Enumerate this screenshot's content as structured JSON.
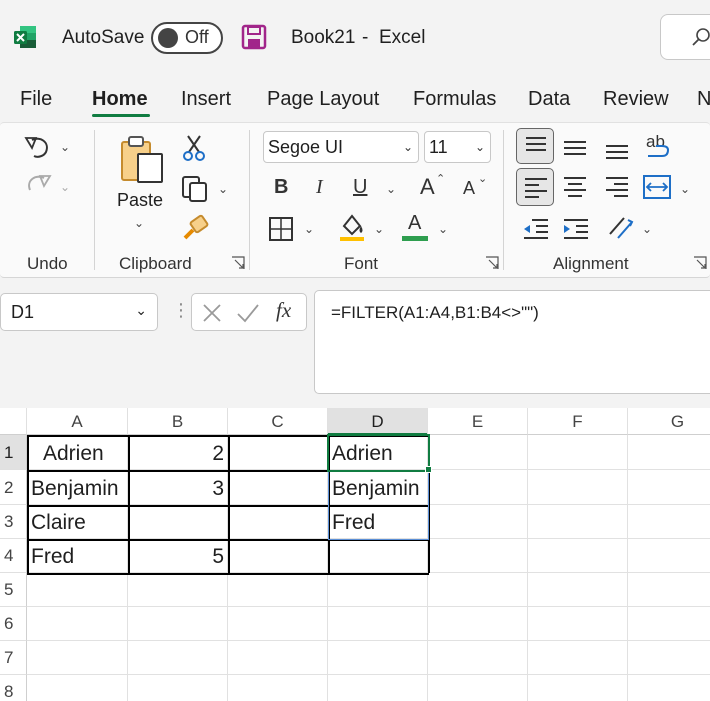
{
  "titlebar": {
    "autosave_label": "AutoSave",
    "autosave_state": "Off",
    "doc_title": "Book21",
    "separator": "-",
    "app_name": "Excel"
  },
  "tabs": [
    "File",
    "Home",
    "Insert",
    "Page Layout",
    "Formulas",
    "Data",
    "Review",
    "N"
  ],
  "active_tab": "Home",
  "ribbon": {
    "groups": {
      "undo": "Undo",
      "clipboard": "Clipboard",
      "font": "Font",
      "alignment": "Alignment"
    },
    "paste_label": "Paste",
    "font_name": "Segoe UI",
    "font_size": "11",
    "bold": "B",
    "italic": "I",
    "underline": "U",
    "grow_font": "A",
    "shrink_font": "A",
    "font_color": "A",
    "wrap_text": "ab",
    "colors": {
      "accent": "#107c41",
      "font_color_bar": "#2e9e4f",
      "fill_bar": "#ffc000"
    }
  },
  "formula_bar": {
    "name_box": "D1",
    "fx": "fx",
    "formula": "=FILTER(A1:A4,B1:B4<>\"\")"
  },
  "sheet": {
    "columns": [
      "A",
      "B",
      "C",
      "D",
      "E",
      "F",
      "G"
    ],
    "selected_column": "D",
    "rows": [
      "1",
      "2",
      "3",
      "4",
      "5",
      "6",
      "7",
      "8"
    ],
    "selected_row": "1",
    "cells": {
      "A1": "Adrien",
      "B1": "2",
      "D1": "Adrien",
      "A2": "Benjamin",
      "B2": "3",
      "D2": "Benjamin",
      "A3": "Claire",
      "D3": "Fred",
      "A4": "Fred",
      "B4": "5"
    },
    "active_cell": "D1",
    "selection_color": "#107c41"
  }
}
